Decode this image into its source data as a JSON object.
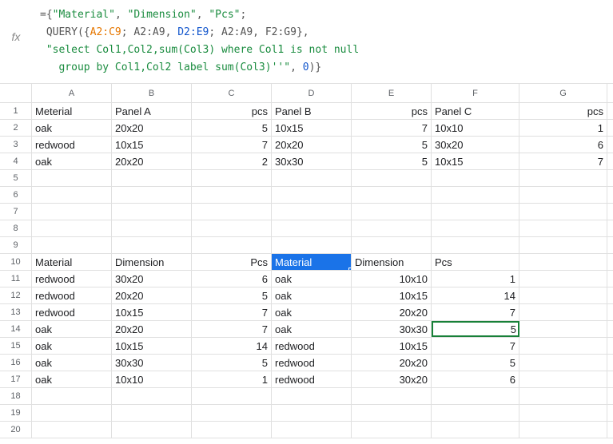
{
  "formula": {
    "line1_pre": "={",
    "line1_str": "\"Material\"",
    "line1_c1": ", ",
    "line1_str2": "\"Dimension\"",
    "line1_c2": ", ",
    "line1_str3": "\"Pcs\"",
    "line1_end": ";",
    "line2_pre": " QUERY({",
    "line2_r1": "A2:C9",
    "line2_c1": "; ",
    "line2_r2": "A2:A9",
    "line2_c2": ", ",
    "line2_r3": "D2:E9",
    "line2_c3": "; ",
    "line2_r4": "A2:A9",
    "line2_c4": ", ",
    "line2_r5": "F2:G9",
    "line2_end": "},",
    "line3": " \"select Col1,Col2,sum(Col3) where Col1 is not null",
    "line4_str": "   group by Col1,Col2 label sum(Col3)''\"",
    "line4_c": ", ",
    "line4_num": "0",
    "line4_end": ")}"
  },
  "fx": "fx",
  "columns": [
    "A",
    "B",
    "C",
    "D",
    "E",
    "F",
    "G"
  ],
  "rowNums": [
    "1",
    "2",
    "3",
    "4",
    "5",
    "6",
    "7",
    "8",
    "9",
    "10",
    "11",
    "12",
    "13",
    "14",
    "15",
    "16",
    "17",
    "18",
    "19",
    "20"
  ],
  "r1": {
    "a": "Meterial",
    "b": "Panel A",
    "c": "pcs",
    "d": "Panel B",
    "e": "pcs",
    "f": "Panel C",
    "g": "pcs"
  },
  "r2": {
    "a": "oak",
    "b": "20x20",
    "c": "5",
    "d": "10x15",
    "e": "7",
    "f": "10x10",
    "g": "1"
  },
  "r3": {
    "a": "redwood",
    "b": "10x15",
    "c": "7",
    "d": "20x20",
    "e": "5",
    "f": "30x20",
    "g": "6"
  },
  "r4": {
    "a": "oak",
    "b": "20x20",
    "c": "2",
    "d": "30x30",
    "e": "5",
    "f": "10x15",
    "g": "7"
  },
  "r10": {
    "a": "Material",
    "b": "Dimension",
    "c": "Pcs",
    "d": "Material",
    "e": "Dimension",
    "f": "Pcs"
  },
  "r11": {
    "a": "redwood",
    "b": "30x20",
    "c": "6",
    "d": "oak",
    "e": "10x10",
    "f": "1"
  },
  "r12": {
    "a": "redwood",
    "b": "20x20",
    "c": "5",
    "d": "oak",
    "e": "10x15",
    "f": "14"
  },
  "r13": {
    "a": "redwood",
    "b": "10x15",
    "c": "7",
    "d": "oak",
    "e": "20x20",
    "f": "7"
  },
  "r14": {
    "a": "oak",
    "b": "20x20",
    "c": "7",
    "d": "oak",
    "e": "30x30",
    "f": "5"
  },
  "r15": {
    "a": "oak",
    "b": "10x15",
    "c": "14",
    "d": "redwood",
    "e": "10x15",
    "f": "7"
  },
  "r16": {
    "a": "oak",
    "b": "30x30",
    "c": "5",
    "d": "redwood",
    "e": "20x20",
    "f": "5"
  },
  "r17": {
    "a": "oak",
    "b": "10x10",
    "c": "1",
    "d": "redwood",
    "e": "30x20",
    "f": "6"
  }
}
